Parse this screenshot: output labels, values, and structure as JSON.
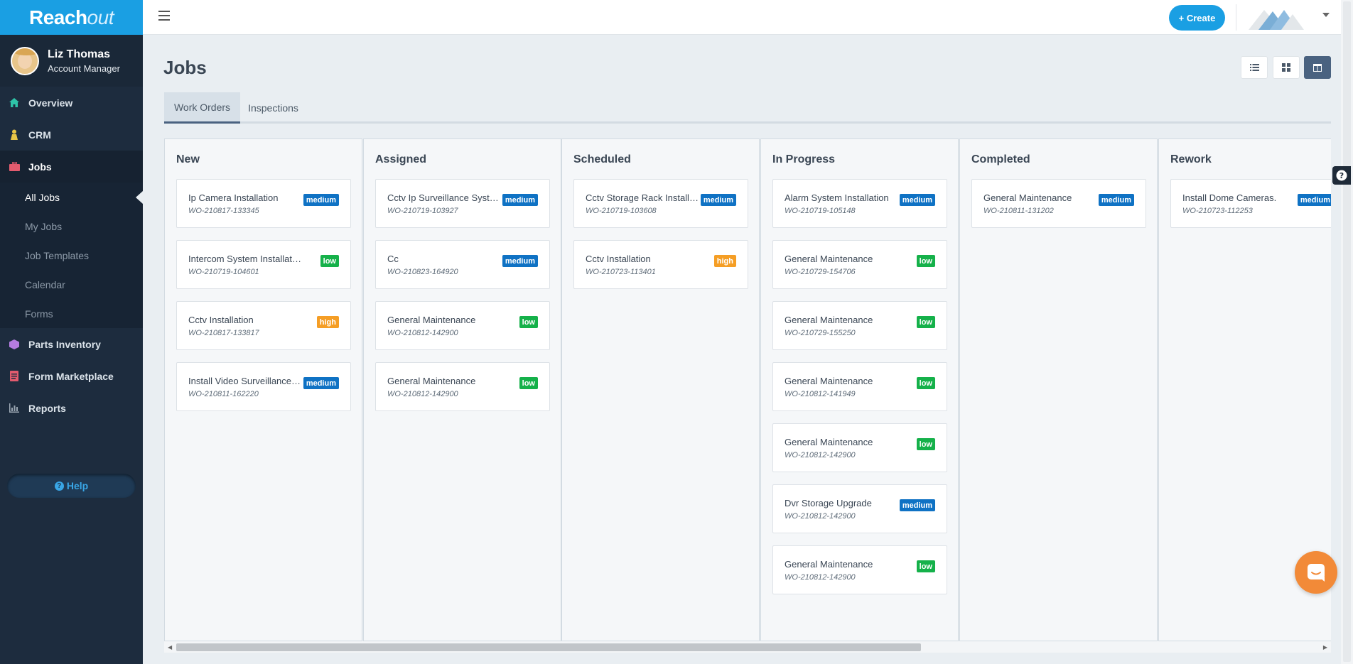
{
  "brand": {
    "reach": "Reach",
    "out": "out"
  },
  "user": {
    "name": "Liz Thomas",
    "role": "Account Manager"
  },
  "nav": {
    "overview": "Overview",
    "crm": "CRM",
    "jobs": "Jobs",
    "parts": "Parts Inventory",
    "marketplace": "Form Marketplace",
    "reports": "Reports"
  },
  "jobs_sub": {
    "all": "All Jobs",
    "my": "My Jobs",
    "templates": "Job Templates",
    "calendar": "Calendar",
    "forms": "Forms"
  },
  "help": "Help",
  "header": {
    "create": "+ Create"
  },
  "page": {
    "title": "Jobs"
  },
  "tabs": {
    "work_orders": "Work Orders",
    "inspections": "Inspections"
  },
  "columns": [
    {
      "title": "New",
      "cards": [
        {
          "title": "Ip Camera Installation",
          "id": "WO-210817-133345",
          "priority": "medium"
        },
        {
          "title": "Intercom System Installation",
          "id": "WO-210719-104601",
          "priority": "low"
        },
        {
          "title": "Cctv Installation",
          "id": "WO-210817-133817",
          "priority": "high"
        },
        {
          "title": "Install Video Surveillance Cameras",
          "id": "WO-210811-162220",
          "priority": "medium"
        }
      ]
    },
    {
      "title": "Assigned",
      "cards": [
        {
          "title": "Cctv Ip Surveillance System",
          "id": "WO-210719-103927",
          "priority": "medium"
        },
        {
          "title": "Cc",
          "id": "WO-210823-164920",
          "priority": "medium"
        },
        {
          "title": "General Maintenance",
          "id": "WO-210812-142900",
          "priority": "low"
        },
        {
          "title": "General Maintenance",
          "id": "WO-210812-142900",
          "priority": "low"
        }
      ]
    },
    {
      "title": "Scheduled",
      "cards": [
        {
          "title": "Cctv Storage Rack Installation",
          "id": "WO-210719-103608",
          "priority": "medium"
        },
        {
          "title": "Cctv Installation",
          "id": "WO-210723-113401",
          "priority": "high"
        }
      ]
    },
    {
      "title": "In Progress",
      "cards": [
        {
          "title": "Alarm System Installation",
          "id": "WO-210719-105148",
          "priority": "medium"
        },
        {
          "title": "General Maintenance",
          "id": "WO-210729-154706",
          "priority": "low"
        },
        {
          "title": "General Maintenance",
          "id": "WO-210729-155250",
          "priority": "low"
        },
        {
          "title": "General Maintenance",
          "id": "WO-210812-141949",
          "priority": "low"
        },
        {
          "title": "General Maintenance",
          "id": "WO-210812-142900",
          "priority": "low"
        },
        {
          "title": "Dvr Storage Upgrade",
          "id": "WO-210812-142900",
          "priority": "medium"
        },
        {
          "title": "General Maintenance",
          "id": "WO-210812-142900",
          "priority": "low"
        }
      ]
    },
    {
      "title": "Completed",
      "cards": [
        {
          "title": "General Maintenance",
          "id": "WO-210811-131202",
          "priority": "medium"
        }
      ]
    },
    {
      "title": "Rework",
      "cards": [
        {
          "title": "Install Dome Cameras.",
          "id": "WO-210723-112253",
          "priority": "medium"
        }
      ]
    }
  ],
  "colors": {
    "accent": "#1a9fe3",
    "sidebar": "#1d2c3e",
    "medium": "#0f72c4",
    "low": "#15b14a",
    "high": "#f59e25"
  }
}
